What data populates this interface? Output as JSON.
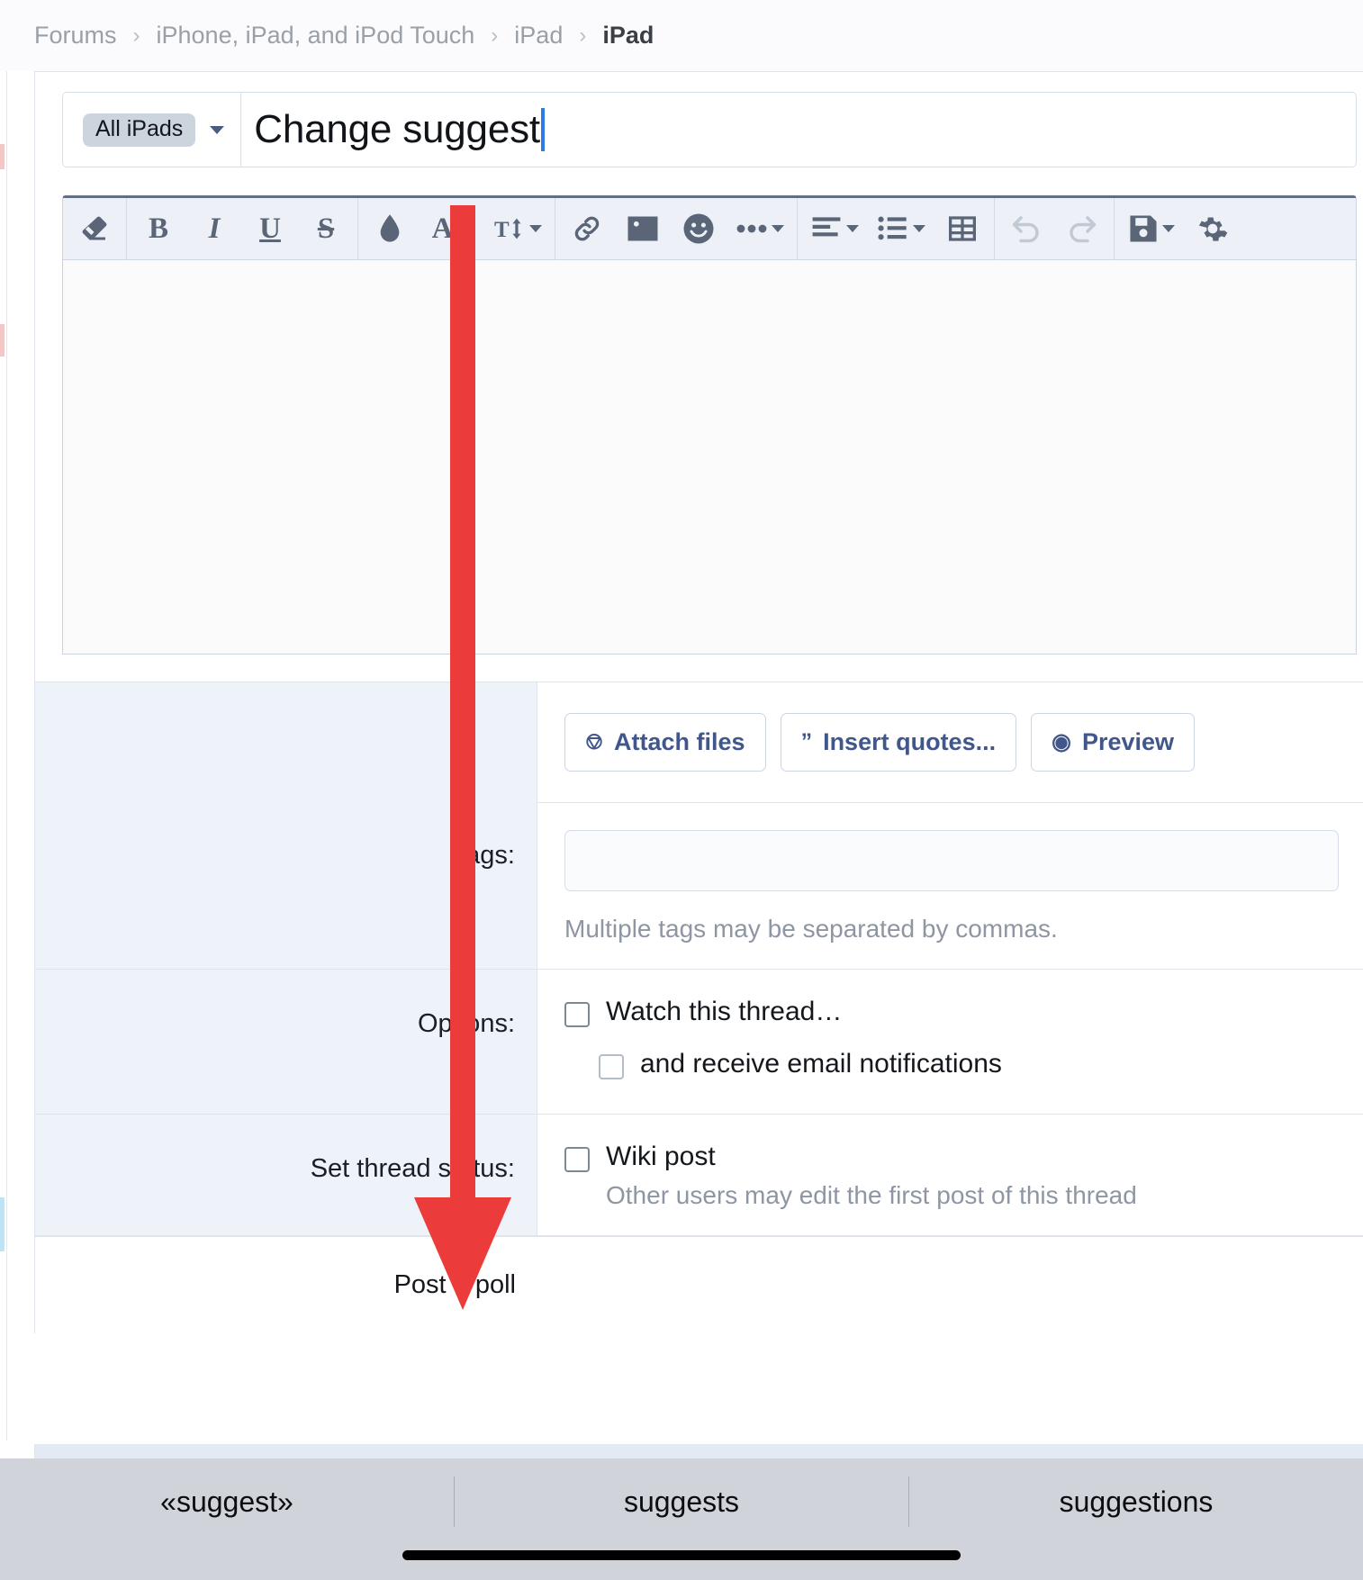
{
  "breadcrumb": {
    "items": [
      {
        "label": "Forums",
        "current": false
      },
      {
        "label": "iPhone, iPad, and iPod Touch",
        "current": false
      },
      {
        "label": "iPad",
        "current": false
      },
      {
        "label": "iPad",
        "current": true
      }
    ],
    "separator": "›"
  },
  "thread_form": {
    "prefix_chip": "All iPads",
    "title_value": "Change suggest",
    "title_placeholder": ""
  },
  "toolbar": {
    "groups": [
      [
        {
          "name": "remove-formatting-icon",
          "glyph": "eraser",
          "caret": false
        }
      ],
      [
        {
          "name": "bold-icon",
          "glyph": "B",
          "caret": false
        },
        {
          "name": "italic-icon",
          "glyph": "I",
          "caret": false
        },
        {
          "name": "underline-icon",
          "glyph": "U",
          "caret": false
        },
        {
          "name": "strikethrough-icon",
          "glyph": "S",
          "caret": false
        }
      ],
      [
        {
          "name": "text-color-icon",
          "glyph": "drop",
          "caret": false
        },
        {
          "name": "font-family-icon",
          "glyph": "A",
          "caret": true
        },
        {
          "name": "font-size-icon",
          "glyph": "Tt",
          "caret": true
        }
      ],
      [
        {
          "name": "insert-link-icon",
          "glyph": "link",
          "caret": false
        },
        {
          "name": "insert-image-icon",
          "glyph": "image",
          "caret": false
        },
        {
          "name": "insert-smilie-icon",
          "glyph": "smiley",
          "caret": false
        },
        {
          "name": "more-options-icon",
          "glyph": "dots",
          "caret": true
        }
      ],
      [
        {
          "name": "text-align-icon",
          "glyph": "align",
          "caret": true
        },
        {
          "name": "list-icon",
          "glyph": "list",
          "caret": true
        },
        {
          "name": "insert-table-icon",
          "glyph": "table",
          "caret": false
        }
      ],
      [
        {
          "name": "undo-icon",
          "glyph": "undo",
          "caret": false,
          "disabled": true
        },
        {
          "name": "redo-icon",
          "glyph": "redo",
          "caret": false,
          "disabled": true
        }
      ],
      [
        {
          "name": "drafts-icon",
          "glyph": "save",
          "caret": true
        },
        {
          "name": "editor-settings-icon",
          "glyph": "gear",
          "caret": false
        }
      ]
    ]
  },
  "actions": {
    "attach_files": "Attach files",
    "insert_quotes": "Insert quotes...",
    "preview": "Preview"
  },
  "fields": {
    "tags_label": "Tags:",
    "tags_value": "",
    "tags_hint": "Multiple tags may be separated by commas.",
    "options_label": "Options:",
    "watch_thread": "Watch this thread…",
    "email_notifications": "and receive email notifications",
    "thread_status_label": "Set thread status:",
    "wiki_post": "Wiki post",
    "wiki_hint": "Other users may edit the first post of this thread",
    "poll_label": "Post a poll"
  },
  "keyboard": {
    "suggestions": [
      "«suggest»",
      "suggests",
      "suggestions"
    ]
  },
  "colors": {
    "accent": "#41578b",
    "annotation": "#ec3b3b",
    "caret": "#2f7ae5",
    "toolbar_bg": "#edf1f7"
  }
}
